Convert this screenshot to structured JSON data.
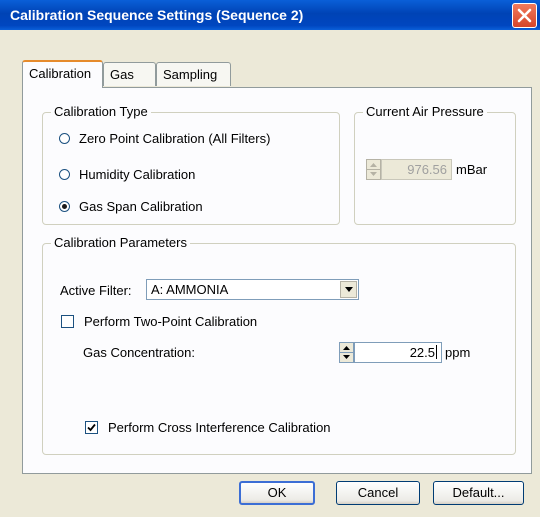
{
  "window": {
    "title": "Calibration Sequence Settings (Sequence 2)"
  },
  "tabs": [
    {
      "label": "Calibration",
      "active": true
    },
    {
      "label": "Gas",
      "active": false
    },
    {
      "label": "Sampling",
      "active": false
    }
  ],
  "calibration_type": {
    "legend": "Calibration Type",
    "options": [
      {
        "label": "Zero Point Calibration (All Filters)",
        "selected": false
      },
      {
        "label": "Humidity Calibration",
        "selected": false
      },
      {
        "label": "Gas Span Calibration",
        "selected": true
      }
    ]
  },
  "air_pressure": {
    "legend": "Current Air Pressure",
    "value": "976.56",
    "unit": "mBar",
    "enabled": false
  },
  "parameters": {
    "legend": "Calibration Parameters",
    "active_filter_label": "Active Filter:",
    "active_filter_value": "A: AMMONIA",
    "two_point_label": "Perform Two-Point Calibration",
    "two_point_checked": false,
    "gas_concentration_label": "Gas Concentration:",
    "gas_concentration_value": "22.5",
    "gas_concentration_unit": "ppm",
    "cross_interference_label": "Perform Cross Interference Calibration",
    "cross_interference_checked": true
  },
  "buttons": {
    "ok": "OK",
    "cancel": "Cancel",
    "default": "Default..."
  },
  "colors": {
    "titlebar": "#0043b5",
    "close": "#d5452a",
    "tab_highlight": "#e68b2c",
    "dialog_bg": "#ece9d8"
  },
  "icons": {
    "close": "close-icon",
    "dropdown": "chevron-down-icon",
    "spin_up": "spin-up-icon",
    "spin_down": "spin-down-icon",
    "check": "checkmark-icon"
  }
}
